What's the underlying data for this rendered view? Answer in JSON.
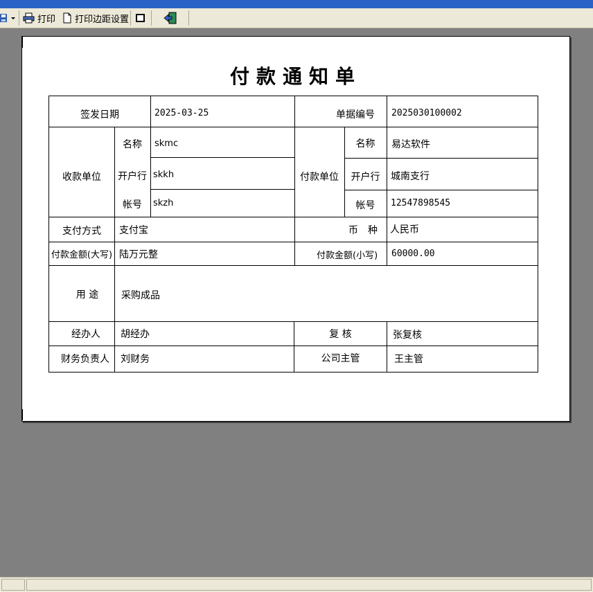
{
  "toolbar": {
    "print_label": "打印",
    "margin_label": "打印边距设置",
    "save_icon": "save-icon",
    "print_icon": "printer-icon",
    "page_icon": "page-setup-icon",
    "frame_icon": "frame-toggle-icon",
    "exit_icon": "exit-door-icon"
  },
  "document": {
    "title": "付款通知单",
    "issue_date_label": "签发日期",
    "issue_date": "2025-03-25",
    "doc_no_label": "单据编号",
    "doc_no": "2025030100002",
    "payee": {
      "label": "收款单位",
      "name_label": "名称",
      "name": "skmc",
      "bank_label": "开户行",
      "bank": "skkh",
      "account_label": "帐号",
      "account": "skzh"
    },
    "payer": {
      "label": "付款单位",
      "name_label": "名称",
      "name": "易达软件",
      "bank_label": "开户行",
      "bank": "城南支行",
      "account_label": "帐号",
      "account": "12547898545"
    },
    "pay_method_label": "支付方式",
    "pay_method": "支付宝",
    "currency_label": "币　种",
    "currency": "人民币",
    "amount_upper_label": "付款金额(大写)",
    "amount_upper": "陆万元整",
    "amount_lower_label": "付款金额(小写)",
    "amount_lower": "60000.00",
    "purpose_label": "用 途",
    "purpose": "采购成品",
    "handler_label": "经办人",
    "handler": "胡经办",
    "reviewer_label": "复 核",
    "reviewer": "张复核",
    "finance_label": "财务负责人",
    "finance": "刘财务",
    "supervisor_label": "公司主管",
    "supervisor": "王主管"
  }
}
